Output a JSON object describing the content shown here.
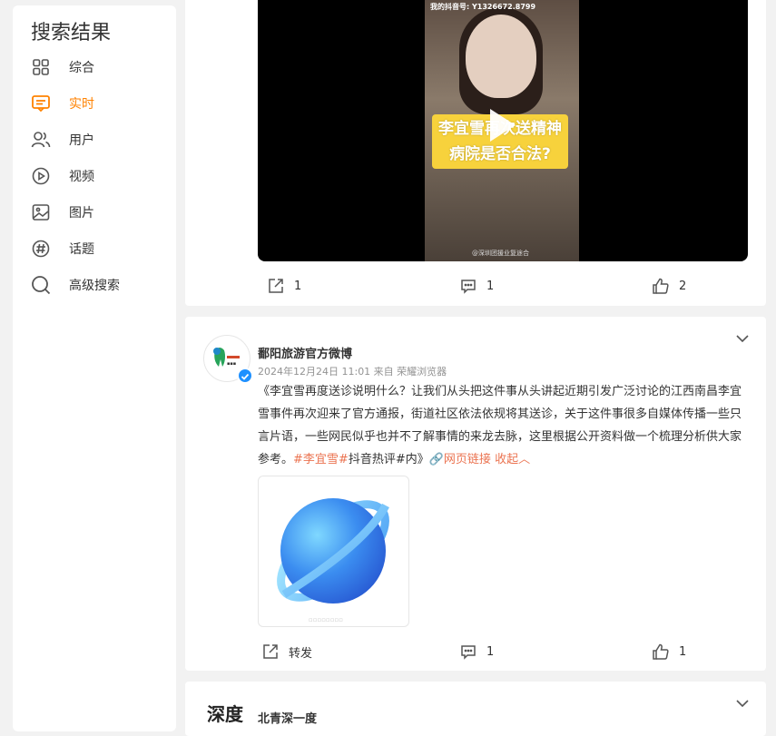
{
  "sidebar": {
    "title": "搜索结果",
    "items": [
      {
        "label": "综合",
        "icon": "grid-icon"
      },
      {
        "label": "实时",
        "icon": "realtime-icon",
        "active": true
      },
      {
        "label": "用户",
        "icon": "users-icon"
      },
      {
        "label": "视频",
        "icon": "video-play-icon"
      },
      {
        "label": "图片",
        "icon": "image-icon"
      },
      {
        "label": "话题",
        "icon": "hashtag-icon"
      },
      {
        "label": "高级搜索",
        "icon": "search-icon"
      }
    ]
  },
  "video_post": {
    "frame_text": "我的抖音号: Y1326672.8799",
    "caption": "李宜雪再次送精神病院是否合法?",
    "watermark": "@深圳团援业复途合",
    "actions": {
      "forward_count": "1",
      "comment_count": "1",
      "like_count": "2"
    }
  },
  "post": {
    "author": "鄱阳旅游官方微博",
    "meta": "2024年12月24日 11:01  来自 荣耀浏览器",
    "text": "《李宜雪再度送诊说明什么？让我们从头把这件事从头讲起近期引发广泛讨论的江西南昌李宜雪事件再次迎来了官方通报，街道社区依法依规将其送诊，关于这件事很多自媒体传播一些只言片语，一些网民似乎也并不了解事情的来龙去脉，这里根据公开资料做一个梳理分析供大家参考。",
    "hashtag": "#李宜雪#",
    "tail": "抖音热评#内》",
    "link_label": "网页链接",
    "collapse_label": "收起",
    "actions": {
      "forward_label": "转发",
      "comment_count": "1",
      "like_count": "1"
    }
  },
  "next_post": {
    "author": "北青深一度",
    "avatar_text": "深度"
  },
  "colors": {
    "accent": "#ff8200",
    "link": "#eb7350",
    "verified": "#1e90ff"
  }
}
